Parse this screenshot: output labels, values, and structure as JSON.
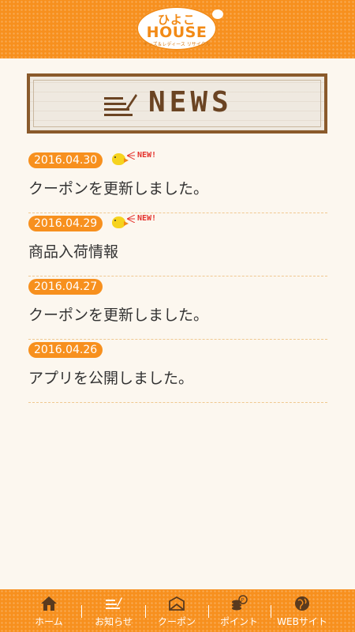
{
  "header": {
    "logo_top": "ひよこ",
    "logo_main": "HOUSE",
    "logo_sub": "キッズ＆レディース リサイクル"
  },
  "banner": {
    "title": "NEWS",
    "icon": "news-icon"
  },
  "news": [
    {
      "date": "2016.04.30",
      "title": "クーポンを更新しました。",
      "is_new": true,
      "new_label": "NEW!"
    },
    {
      "date": "2016.04.29",
      "title": "商品入荷情報",
      "is_new": true,
      "new_label": "NEW!"
    },
    {
      "date": "2016.04.27",
      "title": "クーポンを更新しました。",
      "is_new": false
    },
    {
      "date": "2016.04.26",
      "title": "アプリを公開しました。",
      "is_new": false
    }
  ],
  "tabbar": {
    "tabs": [
      {
        "label": "ホーム",
        "icon": "home-icon",
        "active": false
      },
      {
        "label": "お知らせ",
        "icon": "news-icon",
        "active": true
      },
      {
        "label": "クーポン",
        "icon": "coupon-icon",
        "active": false
      },
      {
        "label": "ポイント",
        "icon": "points-icon",
        "active": false
      },
      {
        "label": "WEBサイト",
        "icon": "globe-icon",
        "active": false
      }
    ]
  },
  "colors": {
    "accent": "#f7901e",
    "text": "#333333",
    "new_badge": "#e4312b",
    "banner_frame": "#8a5a2b"
  }
}
